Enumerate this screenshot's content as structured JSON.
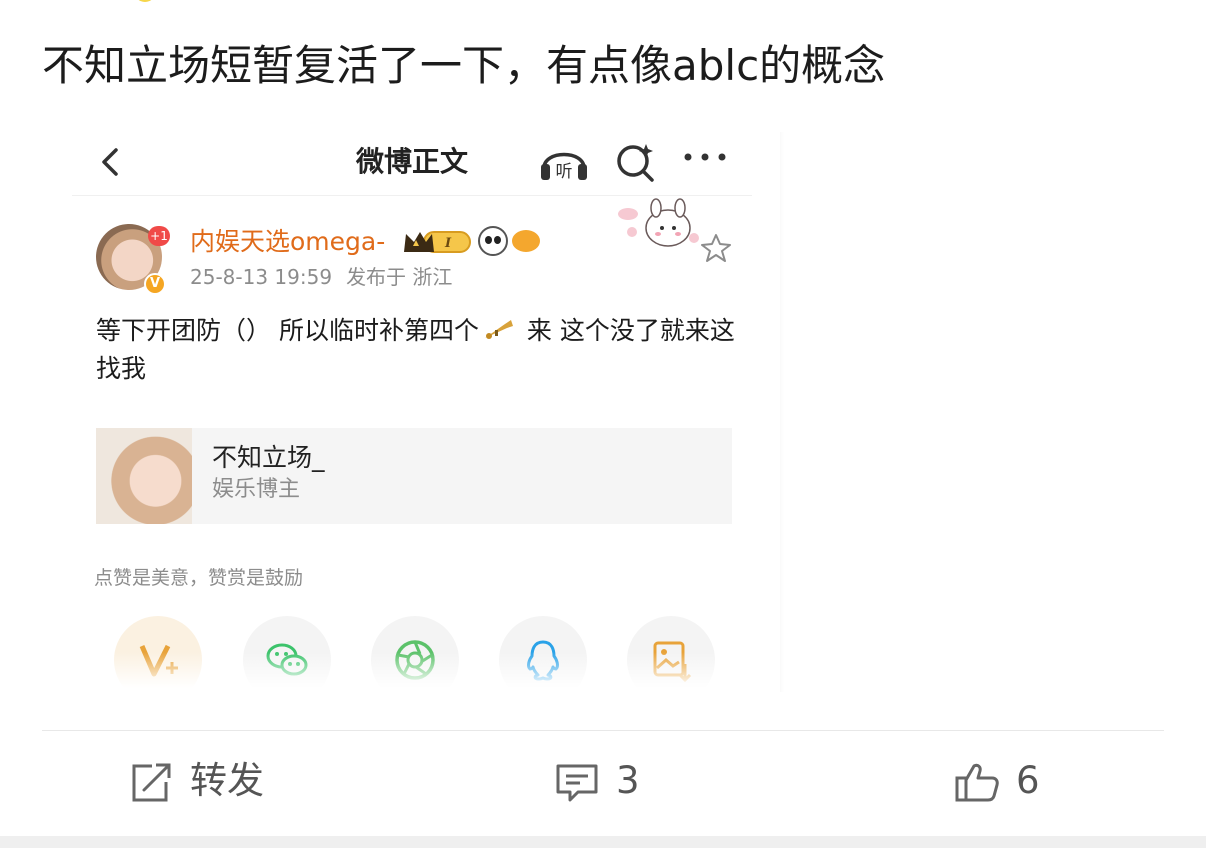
{
  "post": {
    "text": "不知立场短暂复活了一下，有点像ablc的概念"
  },
  "embedded_screenshot": {
    "header": {
      "title": "微博正文",
      "listen_label": "听"
    },
    "author": {
      "name": "内娱天选omega-",
      "badge_count": "+1",
      "verified_mark": "V",
      "level_badge": "I",
      "time": "25-8-13 19:59",
      "location": "发布于 浙江"
    },
    "content": {
      "text_before": "等下开团防（） 所以临时补第四个",
      "text_after": " 来 这个没了就来这找我"
    },
    "card": {
      "name": "不知立场_",
      "subtitle": "娱乐博主"
    },
    "reward_text": "点赞是美意，赞赏是鼓励",
    "share_icons": [
      "vip-icon",
      "wechat-icon",
      "moments-icon",
      "qq-icon",
      "save-image-icon"
    ]
  },
  "actions": {
    "repost_label": "转发",
    "comment_count": "3",
    "like_count": "6"
  },
  "colors": {
    "username_orange": "#e06b1a",
    "gray_text": "#8c8c8c",
    "wechat_green": "#3cc36b",
    "qq_blue": "#2aa2e8",
    "vip_orange": "#e8a33a"
  }
}
